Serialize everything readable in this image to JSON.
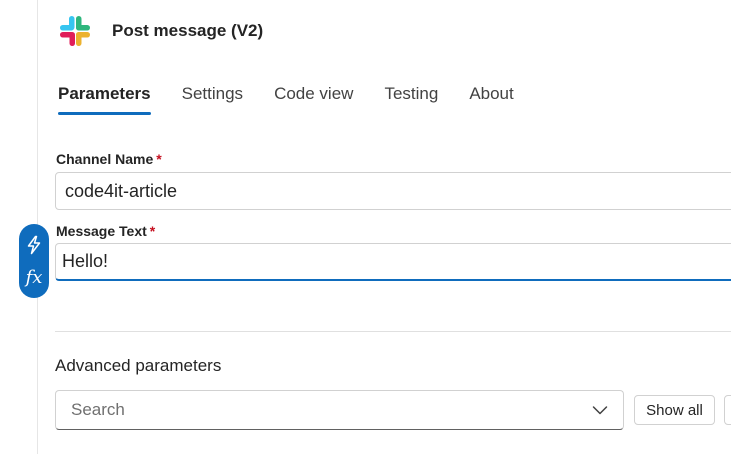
{
  "header": {
    "title": "Post message (V2)",
    "icon": "slack-logo",
    "colors": {
      "red": "#e01e5a",
      "blue": "#36c5f0",
      "green": "#2eb67d",
      "yellow": "#ecb22e"
    }
  },
  "tabs": [
    {
      "label": "Parameters",
      "active": true
    },
    {
      "label": "Settings",
      "active": false
    },
    {
      "label": "Code view",
      "active": false
    },
    {
      "label": "Testing",
      "active": false
    },
    {
      "label": "About",
      "active": false
    }
  ],
  "fields": {
    "channel": {
      "label": "Channel Name",
      "required_mark": "*",
      "value": "code4it-article"
    },
    "message": {
      "label": "Message Text",
      "required_mark": "*",
      "value": "Hello!"
    }
  },
  "expression_toggle": {
    "icons": [
      "lightning-icon",
      "fx-icon"
    ],
    "fx_label": "fx"
  },
  "advanced": {
    "label": "Advanced parameters",
    "search_placeholder": "Search",
    "show_all_label": "Show all"
  },
  "colors": {
    "accent": "#0f6cbd",
    "required": "#c50f1f"
  }
}
